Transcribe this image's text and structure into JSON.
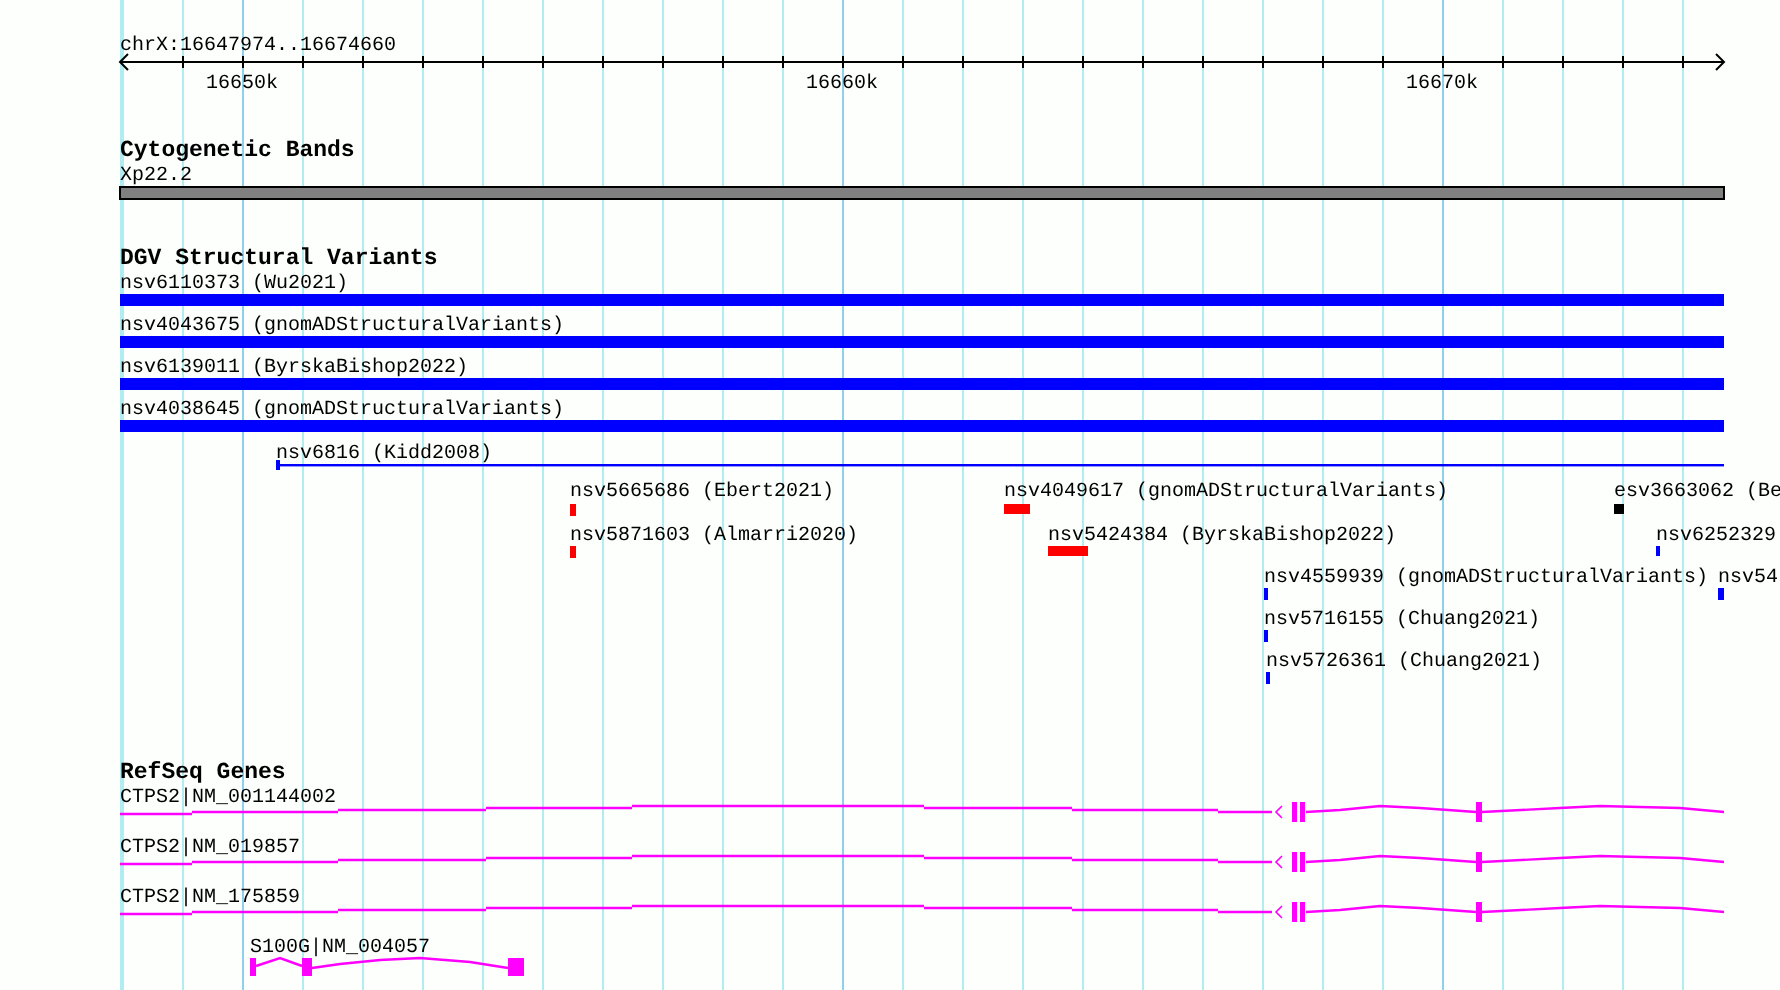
{
  "locus": "chrX:16647974..16674660",
  "axis": {
    "ticks": [
      "16650k",
      "16660k",
      "16670k"
    ]
  },
  "tracks": [
    {
      "title": "Cytogenetic Bands",
      "kind": "bands",
      "features": [
        {
          "label": "Xp22.2",
          "color": "#808080"
        }
      ]
    },
    {
      "title": "DGV Structural Variants",
      "kind": "variants",
      "features": [
        {
          "label": "nsv6110373 (Wu2021)",
          "color": "#0000ff"
        },
        {
          "label": "nsv4043675 (gnomADStructuralVariants)",
          "color": "#0000ff"
        },
        {
          "label": "nsv6139011 (ByrskaBishop2022)",
          "color": "#0000ff"
        },
        {
          "label": "nsv4038645 (gnomADStructuralVariants)",
          "color": "#0000ff"
        },
        {
          "label": "nsv6816 (Kidd2008)",
          "color": "#0000ff"
        },
        {
          "label": "nsv5665686 (Ebert2021)",
          "color": "#ff0000"
        },
        {
          "label": "nsv4049617 (gnomADStructuralVariants)",
          "color": "#ff0000"
        },
        {
          "label": "esv3663062 (Be",
          "color": "#000000"
        },
        {
          "label": "nsv5871603 (Almarri2020)",
          "color": "#ff0000"
        },
        {
          "label": "nsv5424384 (ByrskaBishop2022)",
          "color": "#ff0000"
        },
        {
          "label": "nsv6252329",
          "color": "#0000ff"
        },
        {
          "label": "nsv4559939 (gnomADStructuralVariants)",
          "color": "#0000ff"
        },
        {
          "label": "nsv54",
          "color": "#0000ff"
        },
        {
          "label": "nsv5716155 (Chuang2021)",
          "color": "#0000ff"
        },
        {
          "label": "nsv5726361 (Chuang2021)",
          "color": "#0000ff"
        }
      ]
    },
    {
      "title": "RefSeq Genes",
      "kind": "genes",
      "features": [
        {
          "label": "CTPS2|NM_001144002"
        },
        {
          "label": "CTPS2|NM_019857"
        },
        {
          "label": "CTPS2|NM_175859"
        },
        {
          "label": "S100G|NM_004057"
        }
      ]
    }
  ]
}
